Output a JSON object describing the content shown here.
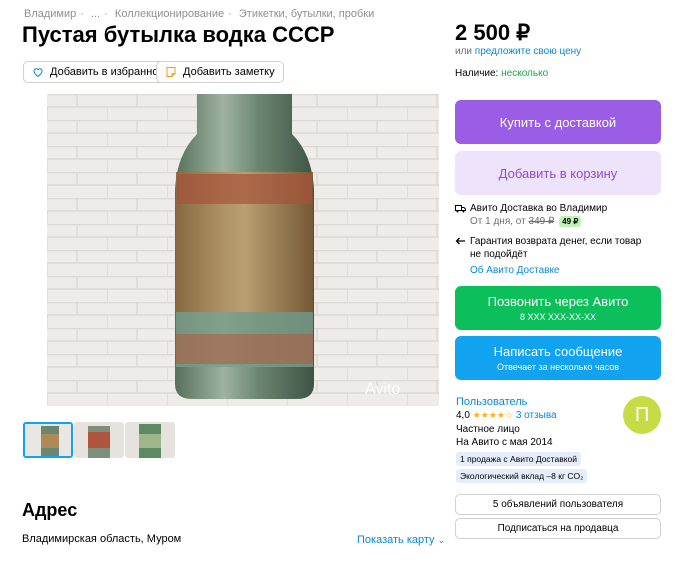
{
  "breadcrumbs": [
    "Владимир",
    "...",
    "Коллекционирование",
    "Этикетки, бутылки, пробки"
  ],
  "title": "Пустая бутылка водка СССР",
  "actions": {
    "favorite": "Добавить в избранное",
    "note": "Добавить заметку"
  },
  "photo": {
    "watermark": "Avito"
  },
  "price": {
    "value": "2 500 ₽",
    "offer_prefix": "или",
    "offer_link": "предложите свою цену",
    "availability_label": "Наличие:",
    "availability_value": "несколько"
  },
  "buttons": {
    "buy": "Купить с доставкой",
    "cart": "Добавить в корзину",
    "call": "Позвонить через Авито",
    "call_sub": "8 XXX XXX-XX-XX",
    "message": "Написать сообщение",
    "message_sub": "Отвечает за несколько часов"
  },
  "delivery": {
    "title": "Авито Доставка во Владимир",
    "time": "От 1 дня, от",
    "old_price": "349 ₽",
    "new_price": "49 ₽",
    "guarantee_line1": "Гарантия возврата денег, если товар",
    "guarantee_line2": "не подойдёт",
    "about_link": "Об Авито Доставке"
  },
  "seller": {
    "name": "Пользователь",
    "rating": "4,0",
    "stars": "★★★★☆",
    "reviews": "3 отзыва",
    "type": "Частное лицо",
    "since": "На Авито с мая 2014",
    "tag1": "1 продажа с Авито Доставкой",
    "tag2": "Экологический вклад –8 кг CO₂",
    "avatar_letter": "П",
    "listings_button": "5 объявлений пользователя",
    "subscribe_button": "Подписаться на продавца"
  },
  "address": {
    "title": "Адрес",
    "text": "Владимирская область, Муром",
    "map_link": "Показать карту"
  },
  "colors": {
    "purple": "#9b5ce6",
    "purple_light": "#efe2fb",
    "green": "#0dbf5a",
    "blue": "#11a2f0",
    "link": "#0a88d8"
  }
}
